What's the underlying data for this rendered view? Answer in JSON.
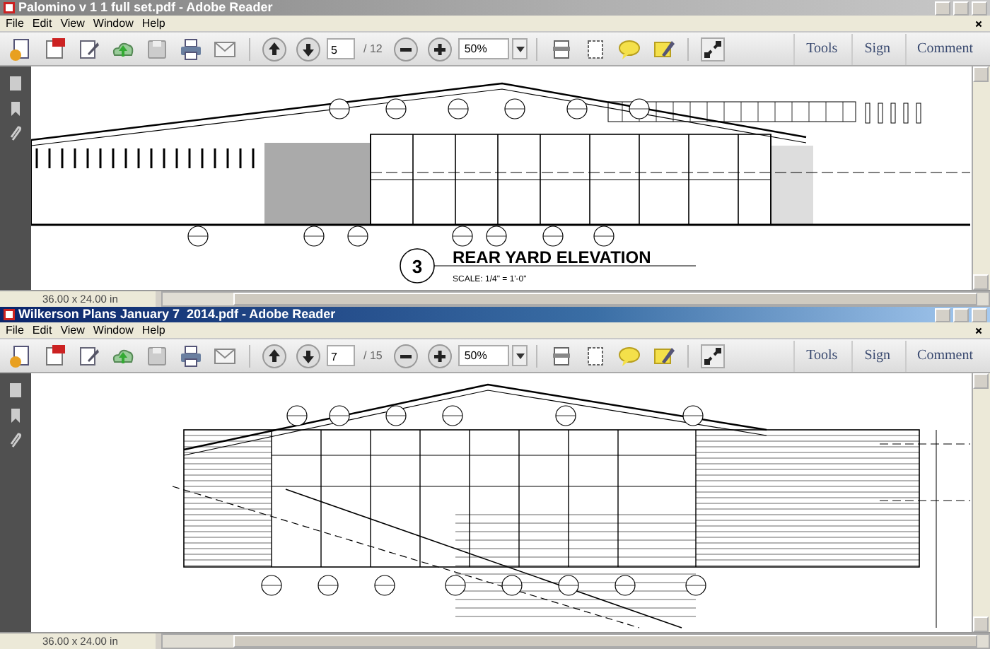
{
  "windows": [
    {
      "title": "Palomino v 1 1 full set.pdf - Adobe Reader",
      "active": false,
      "menu": [
        "File",
        "Edit",
        "View",
        "Window",
        "Help"
      ],
      "page": "5",
      "page_count": "/ 12",
      "zoom": "50%",
      "panels": [
        "Tools",
        "Sign",
        "Comment"
      ],
      "page_size": "36.00 x 24.00 in",
      "drawing": {
        "kind": "rear",
        "number": "3",
        "title": "REAR YARD ELEVATION",
        "scale": "SCALE: 1/4\" = 1'-0\""
      }
    },
    {
      "title": "Wilkerson Plans January 7  2014.pdf - Adobe Reader",
      "active": true,
      "menu": [
        "File",
        "Edit",
        "View",
        "Window",
        "Help"
      ],
      "page": "7",
      "page_count": "/ 15",
      "zoom": "50%",
      "panels": [
        "Tools",
        "Sign",
        "Comment"
      ],
      "page_size": "36.00 x 24.00 in",
      "drawing": {
        "kind": "side"
      }
    }
  ]
}
